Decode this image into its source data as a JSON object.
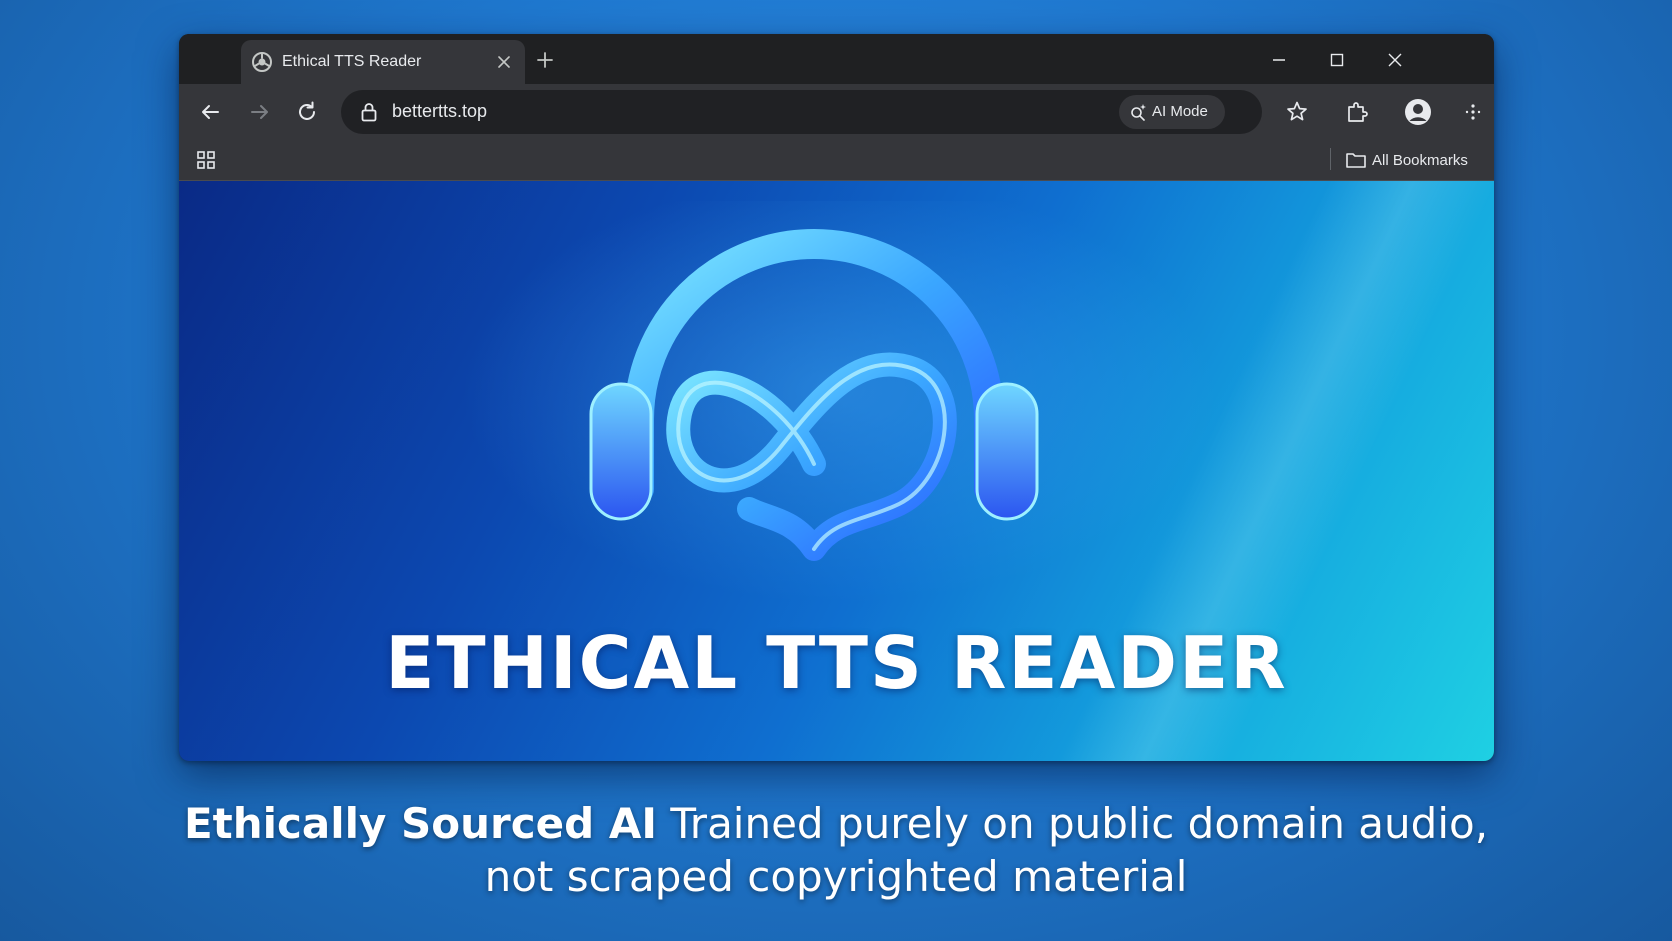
{
  "browser": {
    "tab": {
      "title": "Ethical TTS Reader",
      "favicon": "chrome-favicon-icon"
    },
    "address_bar": {
      "url": "bettertts.top",
      "ai_mode_label": "AI Mode"
    },
    "bookmarks_bar": {
      "all_bookmarks_label": "All Bookmarks"
    },
    "icons": [
      "back-icon",
      "forward-icon",
      "reload-icon",
      "lock-icon",
      "star-icon",
      "extensions-icon",
      "profile-icon",
      "menu-icon",
      "apps-icon",
      "folder-icon",
      "minimize-icon",
      "maximize-icon",
      "close-icon",
      "new-tab-icon"
    ]
  },
  "page": {
    "hero_title": "ETHICAL TTS READER",
    "logo": "headphones-infinity-logo"
  },
  "caption": {
    "bold": "Ethically Sourced AI",
    "text": "Trained purely on public domain audio,",
    "line2": "not scraped copyrighted material"
  },
  "colors": {
    "background": "#1f78cf",
    "browser_frame": "#1f2022",
    "toolbar": "#35363a",
    "omnibox": "#202124",
    "hero_gradient_start": "#0a2a86",
    "hero_gradient_end": "#1fd0e3"
  }
}
